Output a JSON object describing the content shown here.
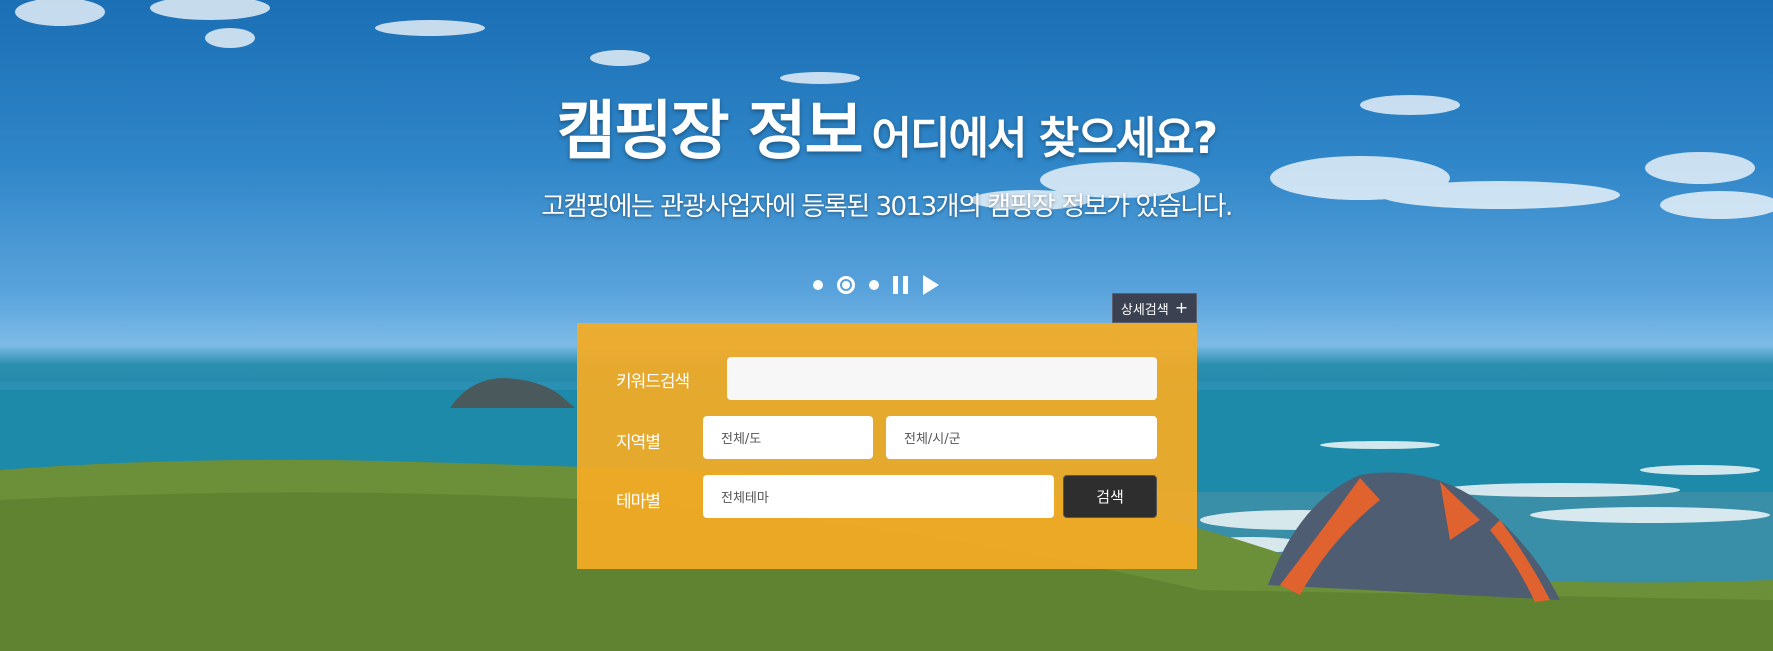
{
  "hero": {
    "title_strong": "캠핑장 정보",
    "title_light": "어디에서 찾으세요?",
    "subtitle": "고캠핑에는 관광사업자에 등록된 3013개의 캠핑장 정보가 있습니다."
  },
  "slider": {
    "active_index": 1,
    "dot_count": 3,
    "pause_icon": "pause-icon",
    "play_icon": "play-icon"
  },
  "search": {
    "detail_label": "상세검색",
    "detail_icon": "plus-icon",
    "keyword_label": "키워드검색",
    "keyword_value": "",
    "region_label": "지역별",
    "province_value": "전체/도",
    "city_value": "전체/시/군",
    "theme_label": "테마별",
    "theme_value": "전체테마",
    "search_button": "검색"
  },
  "colors": {
    "panel": "#F4AB25",
    "button_dark": "#2E2E2E",
    "detail_button": "#3B4150"
  }
}
